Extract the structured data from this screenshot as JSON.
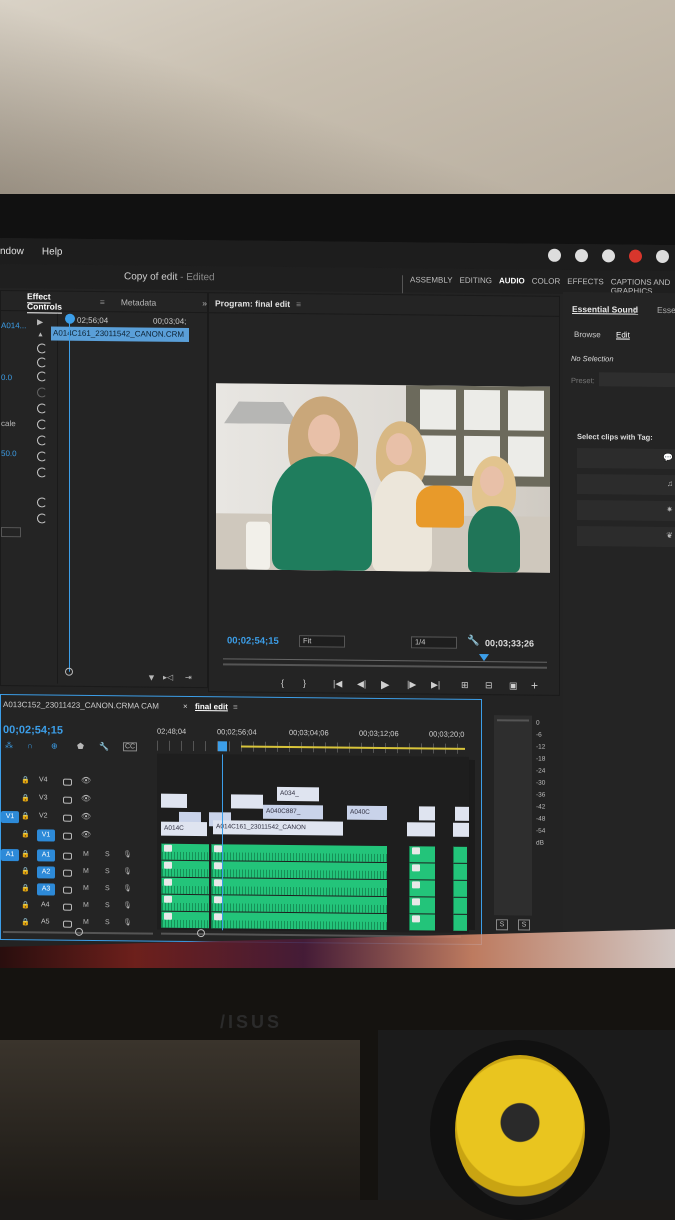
{
  "menu": {
    "items": [
      "ndow",
      "Help"
    ]
  },
  "title": {
    "doc": "Copy of edit",
    "sep": " - ",
    "status": "Edited"
  },
  "workspaces": [
    "ASSEMBLY",
    "EDITING",
    "AUDIO",
    "COLOR",
    "EFFECTS",
    "CAPTIONS AND GRAPHICS"
  ],
  "workspace_active": "AUDIO",
  "effect_controls": {
    "tab": "Effect Controls",
    "tab2": "Metadata",
    "left_values": [
      "A014...",
      "0.0",
      "cale",
      "50.0"
    ],
    "ruler_start": "02;56;04",
    "ruler_end": "00;03;04;",
    "clip_name": "A014C161_23011542_CANON.CRM"
  },
  "program": {
    "tab": "Program: final edit",
    "timecode": "00;02;54;15",
    "fit": "Fit",
    "quality": "1/4",
    "duration": "00;03;33;26"
  },
  "essential_sound": {
    "tab": "Essential Sound",
    "tab2": "Essen",
    "sub_browse": "Browse",
    "sub_edit": "Edit",
    "selection": "No Selection",
    "preset_label": "Preset:",
    "tag_label": "Select clips with Tag:"
  },
  "sequence": {
    "tab_source": "A013C152_23011423_CANON.CRMA CAM",
    "tab_active": "final edit",
    "timecode": "00;02;54;15",
    "ruler": [
      "02;48;04",
      "00;02;56;04",
      "00;03;04;06",
      "00;03;12;06",
      "00;03;20;0"
    ],
    "video_tracks": [
      "V4",
      "V3",
      "V2",
      "V1"
    ],
    "audio_tracks": [
      "A1",
      "A2",
      "A3",
      "A4",
      "A5"
    ],
    "src_v": "V1",
    "src_a": "A1",
    "clips": {
      "c1": "A034_",
      "c2": "A040C887_",
      "c3": "A040C",
      "c4": "A014C",
      "c5": "A014C161_23011542_CANON"
    },
    "m_label": "M",
    "s_label": "S"
  },
  "meter": {
    "scale": [
      "0",
      "-6",
      "-12",
      "-18",
      "-24",
      "-30",
      "-36",
      "-42",
      "-48",
      "-54",
      "dB"
    ],
    "solo_left": "S",
    "solo_right": "S"
  },
  "brand": "/ISUS"
}
